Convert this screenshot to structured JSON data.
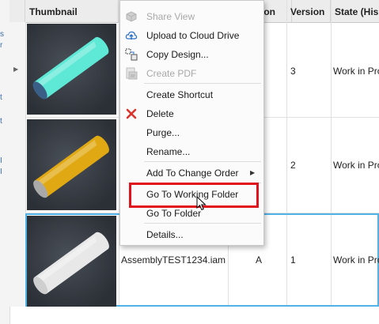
{
  "grid": {
    "columns": {
      "thumbnail": "Thumbnail",
      "revision_partial": "ion",
      "version": "Version",
      "state": "State (His"
    },
    "rows": [
      {
        "file_name": "",
        "revision": "",
        "version": "3",
        "state": "Work in Pro",
        "cylinder_color": "#5ee8d6",
        "cap_color": "#3a5f86"
      },
      {
        "file_name": "",
        "revision": "",
        "version": "2",
        "state": "Work in Pro",
        "cylinder_color": "#e0a812",
        "cap_color": "#a9a9a9"
      },
      {
        "file_name": "AssemblyTEST1234.iam",
        "revision": "A",
        "version": "1",
        "state": "Work in Pro",
        "cylinder_color": "#e8e8e8",
        "cap_color": "#cfcfcf"
      }
    ]
  },
  "left_strip_chars": [
    "s",
    "r",
    "t",
    "t",
    "I",
    "I"
  ],
  "context_menu": {
    "items": [
      {
        "label": "Share View",
        "disabled": true,
        "icon": "share-view-icon"
      },
      {
        "label": "Upload to Cloud Drive",
        "disabled": false,
        "icon": "cloud-upload-icon"
      },
      {
        "label": "Copy Design...",
        "disabled": false,
        "icon": "copy-design-icon"
      },
      {
        "label": "Create PDF",
        "disabled": true,
        "icon": "pdf-icon"
      },
      {
        "label": "Create Shortcut",
        "disabled": false,
        "icon": ""
      },
      {
        "label": "Delete",
        "disabled": false,
        "icon": "delete-x-icon"
      },
      {
        "label": "Purge...",
        "disabled": false,
        "icon": ""
      },
      {
        "label": "Rename...",
        "disabled": false,
        "icon": ""
      },
      {
        "label": "Add To Change Order",
        "disabled": false,
        "icon": "",
        "submenu": true
      },
      {
        "label": "Go To Working Folder",
        "disabled": false,
        "icon": "",
        "highlighted": true
      },
      {
        "label": "Go To Folder",
        "disabled": false,
        "icon": ""
      },
      {
        "label": "Details...",
        "disabled": false,
        "icon": ""
      }
    ]
  },
  "colors": {
    "highlight_box": "#e0121c",
    "selection_border": "#4fb3e8",
    "delete_icon": "#d9342b",
    "upload_icon": "#2a6fc9"
  }
}
